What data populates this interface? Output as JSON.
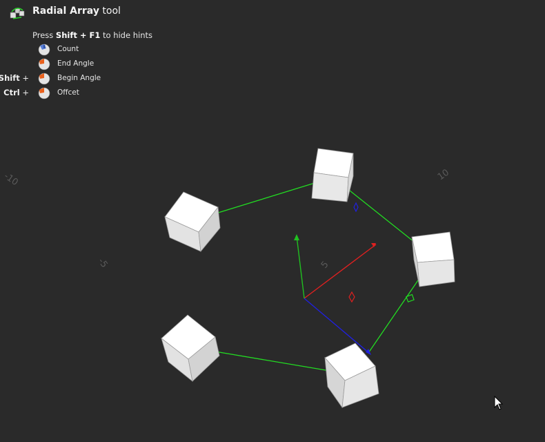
{
  "tool": {
    "name_bold": "Radial Array",
    "name_rest": " tool",
    "icon": "radial-array-tool-icon"
  },
  "hints": {
    "prefix": "Press ",
    "shortcut": "Shift + F1",
    "suffix": " to hide hints",
    "items": [
      {
        "modifier": "",
        "label": "Count",
        "icon": "mouse-scroll-icon"
      },
      {
        "modifier": "",
        "label": "End Angle",
        "icon": "mouse-left-button-icon"
      },
      {
        "modifier": "Shift",
        "label": "Begin Angle",
        "icon": "mouse-left-button-icon"
      },
      {
        "modifier": "Ctrl",
        "label": "Offcet",
        "icon": "mouse-left-button-icon"
      }
    ]
  },
  "grid_labels": {
    "neg10": "-10",
    "pos10": "10",
    "neg5": "-5",
    "pos5": "5"
  },
  "colors": {
    "background": "#2a2a2a",
    "x_axis": "#e02020",
    "y_axis": "#20c020",
    "z_axis": "#2020e0",
    "array_link": "#22dd22",
    "cube_face": "#ececec"
  }
}
